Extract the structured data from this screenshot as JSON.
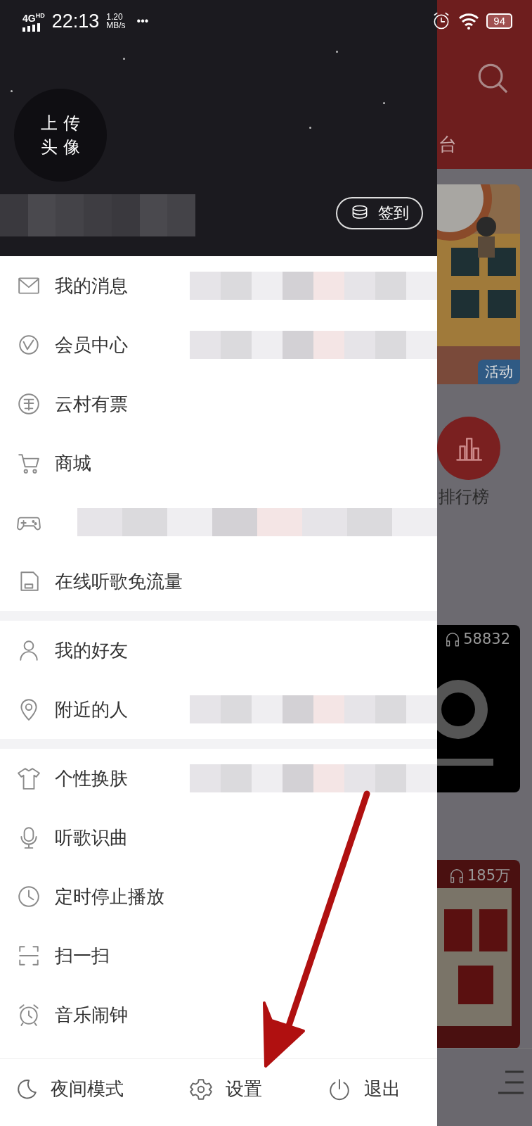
{
  "status_bar": {
    "network": "4G",
    "network_sup": "HD",
    "time": "22:13",
    "speed": "1.20",
    "speed_unit": "MB/s",
    "more": "•••",
    "battery": "94"
  },
  "header": {
    "avatar_lines": [
      "上 传",
      "头 像"
    ],
    "username_blurred": true,
    "checkin": "签到"
  },
  "menu_groups": [
    [
      {
        "label": "我的消息",
        "blurred": true
      },
      {
        "label": "会员中心",
        "blurred": true
      },
      {
        "label": "云村有票",
        "blurred": false
      },
      {
        "label": "商城",
        "blurred": false
      },
      {
        "blurred": true
      },
      {
        "label": "在线听歌免流量",
        "blurred": false
      }
    ],
    [
      {
        "label": "我的好友",
        "blurred": false
      },
      {
        "label": "附近的人",
        "blurred": true
      }
    ],
    [
      {
        "label": "个性换肤",
        "blurred": true
      },
      {
        "label": "听歌识曲",
        "blurred": false
      },
      {
        "label": "定时停止播放",
        "blurred": false
      },
      {
        "label": "扫一扫",
        "blurred": false
      },
      {
        "label": "音乐闹钟",
        "blurred": false
      }
    ]
  ],
  "bottom_bar": [
    "夜间模式",
    "设置",
    "退出"
  ],
  "background_app": {
    "tab": "台",
    "badge": "活动",
    "ranking": "排行榜",
    "play_count_1": "58832",
    "play_count_2": "185万"
  }
}
